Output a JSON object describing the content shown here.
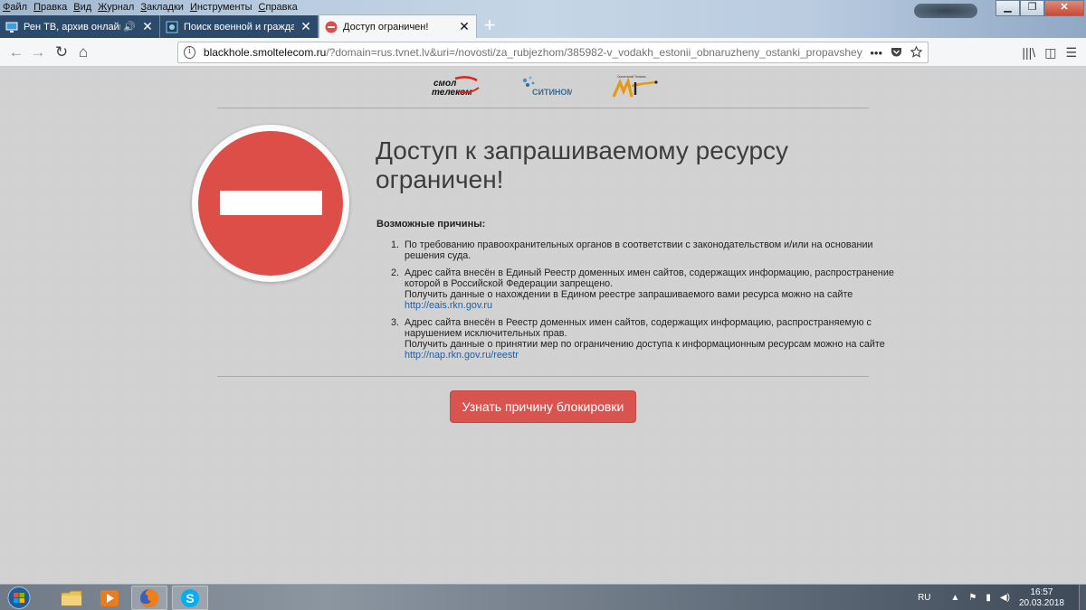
{
  "menubar": [
    "Файл",
    "Правка",
    "Вид",
    "Журнал",
    "Закладки",
    "Инструменты",
    "Справка"
  ],
  "window_controls": {
    "minimize": "▁",
    "maximize": "❐",
    "close": "✕"
  },
  "tabs": [
    {
      "title": "Рен ТВ, архив онлайн. Теле",
      "sound": "🔊",
      "close": "✕"
    },
    {
      "title": "Поиск военной и гражданской",
      "close": "✕"
    },
    {
      "title": "Доступ ограничен!",
      "close": "✕"
    }
  ],
  "new_tab": "+",
  "nav": {
    "back": "←",
    "forward": "→",
    "reload": "↻",
    "home": "⌂",
    "url_host": "blackhole.smoltelecom.ru",
    "url_rest": "/?domain=rus.tvnet.lv&uri=/novosti/za_rubjezhom/385982-v_vodakh_estonii_obnaruzheny_ostanki_propavshey_vo_vremya_",
    "page_actions": "•••",
    "library": "|||\\",
    "sidebar": "◫",
    "menu": "☰"
  },
  "page": {
    "logos": {
      "smoltelecom_a": "смол",
      "smoltelecom_b": "телеком",
      "sitynom": "СИТИНОМ",
      "third_caption": "Смоленский Телеком"
    },
    "headline": "Доступ к запрашиваемому ресурсу ограничен!",
    "reasons_title": "Возможные причины:",
    "reasons": [
      {
        "num": "1.",
        "text": "По требованию правоохранительных органов в соответствии с законодательством и/или на основании решения суда."
      },
      {
        "num": "2.",
        "text": "Адрес сайта внесён в Единый Реестр доменных имен сайтов, содержащих информацию, распространение которой в Российской Федерации запрещено.",
        "note": "Получить данные о нахождении в Едином реестре запрашиваемого вами ресурса можно на сайте",
        "link": "http://eais.rkn.gov.ru"
      },
      {
        "num": "3.",
        "text": "Адрес сайта внесён в Реестр доменных имен сайтов, содержащих информацию, распространяемую с нарушением исключительных прав.",
        "note": "Получить данные о принятии мер по ограничению доступа к информационным ресурсам можно на сайте",
        "link": "http://nap.rkn.gov.ru/reestr"
      }
    ],
    "button_label": "Узнать причину блокировки"
  },
  "taskbar": {
    "lang": "RU",
    "time": "16:57",
    "date": "20.03.2018",
    "tray_symbols": {
      "up": "▲",
      "flag": "⚑",
      "signal": "▮",
      "volume": "◀)"
    }
  },
  "colors": {
    "stop_red": "#dc4e47",
    "button_red": "#d9534f",
    "link_blue": "#1f5fa8",
    "page_bg": "#d1d1d1"
  }
}
